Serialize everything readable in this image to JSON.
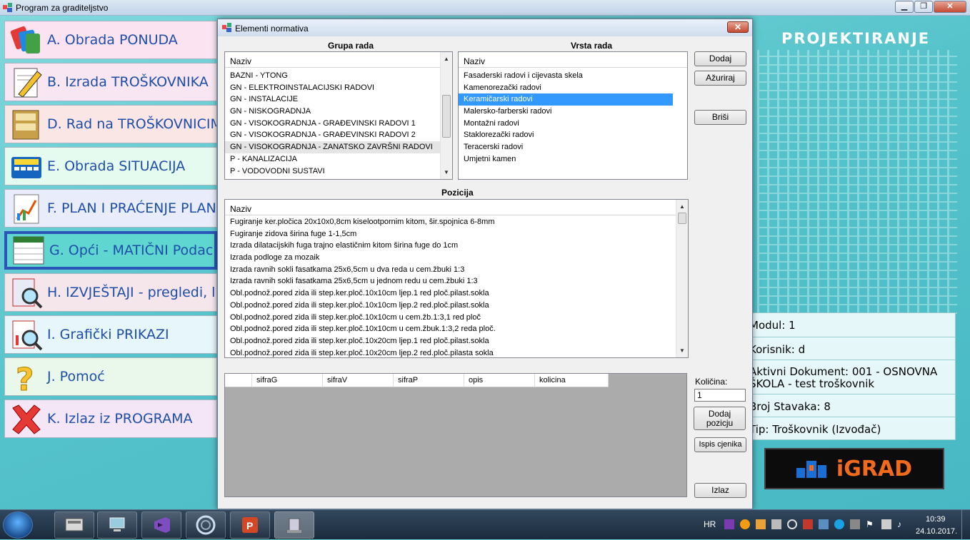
{
  "app": {
    "title": "Program za graditeljstvo"
  },
  "menu": [
    {
      "label": "A. Obrada PONUDA",
      "icon": "tags-icon",
      "selected": false
    },
    {
      "label": "B. Izrada TROŠKOVNIKA",
      "icon": "pencil-document-icon",
      "selected": false
    },
    {
      "label": "D. Rad na TROŠKOVNICIMA",
      "icon": "file-cabinet-icon",
      "selected": false
    },
    {
      "label": "E. Obrada SITUACIJA",
      "icon": "calculator-icon",
      "selected": false
    },
    {
      "label": "F. PLAN I PRAĆENJE PLANA",
      "icon": "chart-icon",
      "selected": false
    },
    {
      "label": "G. Opći - MATIČNI Podaci",
      "icon": "table-document-icon",
      "selected": true
    },
    {
      "label": "H. IZVJEŠTAJI - pregledi, liste",
      "icon": "magnifier-report-icon",
      "selected": false
    },
    {
      "label": "I. Grafički PRIKAZI",
      "icon": "magnifier-chart-icon",
      "selected": false
    },
    {
      "label": "J. Pomoć",
      "icon": "question-mark-icon",
      "selected": false
    },
    {
      "label": "K. Izlaz iz PROGRAMA",
      "icon": "red-x-icon",
      "selected": false
    }
  ],
  "header": {
    "projektiranje": "PROJEKTIRANJE"
  },
  "info": {
    "modul": "Modul: 1",
    "korisnik": "Korisnik: d",
    "dokument": "Aktivni Dokument: 001 - OSNOVNA ŠKOLA - test troškovnik",
    "stavke": "Broj Stavaka: 8",
    "tip": "Tip: Troškovnik (Izvođač)"
  },
  "logo": {
    "text": "iGRAD"
  },
  "dialog": {
    "title": "Elementi normativa",
    "close_label": "✕",
    "grupa": {
      "label": "Grupa rada",
      "header": "Naziv",
      "items": [
        "BAZNI - YTONG",
        "GN - ELEKTROINSTALACIJSKI RADOVI",
        "GN - INSTALACIJE",
        "GN - NISKOGRADNJA",
        "GN - VISOKOGRADNJA - GRAĐEVINSKI RADOVI 1",
        "GN - VISOKOGRADNJA - GRAĐEVINSKI RADOVI 2",
        "GN - VISOKOGRADNJA - ZANATSKO ZAVRŠNI RADOVI",
        "P - KANALIZACIJA",
        "P - VODOVODNI SUSTAVI"
      ]
    },
    "vrsta": {
      "label": "Vrsta rada",
      "header": "Naziv",
      "items": [
        "Fasaderski radovi i cijevasta skela",
        "Kamenorezački radovi",
        "Keramičarski radovi",
        "Malersko-farberski radovi",
        "Montažni radovi",
        "Staklorezački radovi",
        "Teracerski radovi",
        "Umjetni kamen"
      ]
    },
    "pozicija": {
      "label": "Pozicija",
      "header": "Naziv",
      "items": [
        "Fugiranje ker.pločica 20x10x0,8cm kiselootpornim kitom, šir.spojnica 6-8mm",
        "Fugiranje zidova širina fuge 1-1,5cm",
        "Izrada dilatacijskih fuga trajno elastičnim kitom širina fuge do 1cm",
        "Izrada podloge za mozaik",
        "Izrada ravnih sokli fasatkama 25x6,5cm u dva reda u cem.žbuki 1:3",
        "Izrada ravnih sokli fasatkama 25x6,5cm u jednom redu u cem.žbuki 1:3",
        "Obl.podnož.pored zida ili step.ker.ploč.10x10cm ljep.1 red ploč.pilast.sokla",
        "Obl.podnož.pored zida ili step.ker.ploč.10x10cm ljep.2 red.ploč.pilast.sokla",
        "Obl.podnož.pored zida ili step.ker.ploč.10x10cm u cem.žb.1:3,1 red ploč",
        "Obl.podnož.pored zida ili step.ker.ploč.10x10cm u cem.žbuk.1:3,2 reda ploč.",
        "Obl.podnož.pored zida ili step.ker.ploč.10x20cm ljep.1 red ploč.pilast.sokla",
        "Obl.podnož.pored zida ili step.ker.ploč.10x20cm ljep.2 red.ploč.pilasta sokla"
      ]
    },
    "grid": {
      "columns": [
        "sifraG",
        "sifraV",
        "sifraP",
        "opis",
        "kolicina"
      ]
    },
    "buttons": {
      "dodaj": "Dodaj",
      "azuriraj": "Ažuriraj",
      "brisi": "Briši",
      "dodaj_poziciju": "Dodaj pozicju",
      "ispis": "Ispis cjenika",
      "izlaz": "Izlaz"
    },
    "kolicina": {
      "label": "Količina:",
      "value": "1"
    }
  },
  "taskbar": {
    "lang": "HR",
    "time": "10:39",
    "date": "24.10.2017."
  }
}
